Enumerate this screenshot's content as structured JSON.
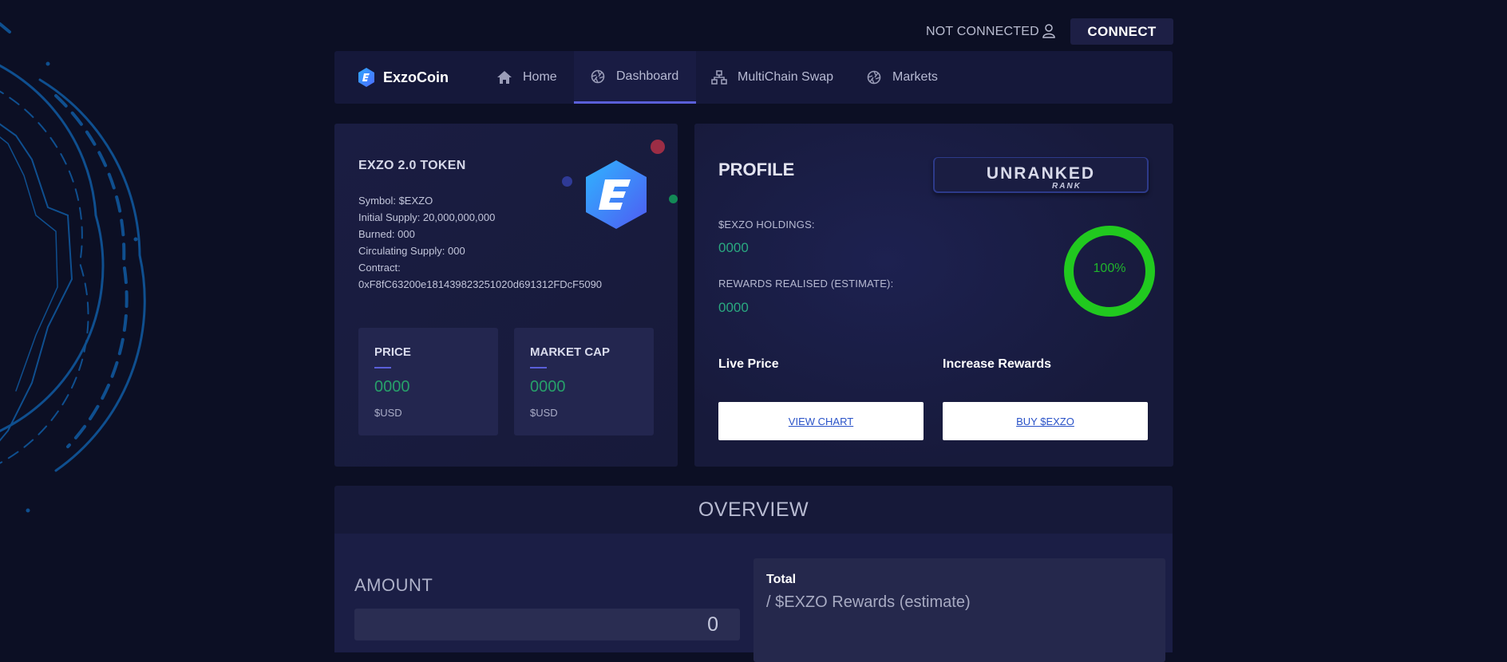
{
  "topbar": {
    "status_text": "NOT CONNECTED",
    "connect_label": "CONNECT"
  },
  "nav": {
    "brand": "ExzoCoin",
    "items": [
      {
        "label": "Home",
        "icon": "home-icon",
        "active": false
      },
      {
        "label": "Dashboard",
        "icon": "aperture-icon",
        "active": true
      },
      {
        "label": "MultiChain Swap",
        "icon": "network-icon",
        "active": false
      },
      {
        "label": "Markets",
        "icon": "aperture-icon",
        "active": false
      }
    ]
  },
  "token": {
    "title": "EXZO 2.0 TOKEN",
    "symbol": "Symbol: $EXZO",
    "initial_supply": "Initial Supply: 20,000,000,000",
    "burned": "Burned: 000",
    "circulating": "Circulating Supply: 000",
    "contract_label": "Contract:",
    "contract_address": "0xF8fC63200e181439823251020d691312FDcF5090",
    "price": {
      "title": "PRICE",
      "value": "0000",
      "unit": "$USD"
    },
    "market_cap": {
      "title": "MARKET CAP",
      "value": "0000",
      "unit": "$USD"
    }
  },
  "profile": {
    "title": "PROFILE",
    "rank": "UNRANKED",
    "rank_sub": "RANK",
    "holdings_label": "$EXZO HOLDINGS:",
    "holdings_value": "0000",
    "rewards_label": "REWARDS REALISED (ESTIMATE):",
    "rewards_value": "0000",
    "ring_percent": "100%",
    "live_price_label": "Live Price",
    "increase_rewards_label": "Increase Rewards",
    "view_chart_label": "VIEW CHART",
    "buy_label": "BUY $EXZO"
  },
  "overview": {
    "title": "OVERVIEW",
    "amount_label": "AMOUNT",
    "amount_value": "0",
    "total_title": "Total",
    "total_sub": "/ $EXZO Rewards (estimate)"
  },
  "colors": {
    "background": "#0c0f24",
    "accent": "#5a5fd9",
    "value_green": "#27a06a",
    "ring_green": "#20c21e",
    "link_blue": "#2952c8"
  }
}
